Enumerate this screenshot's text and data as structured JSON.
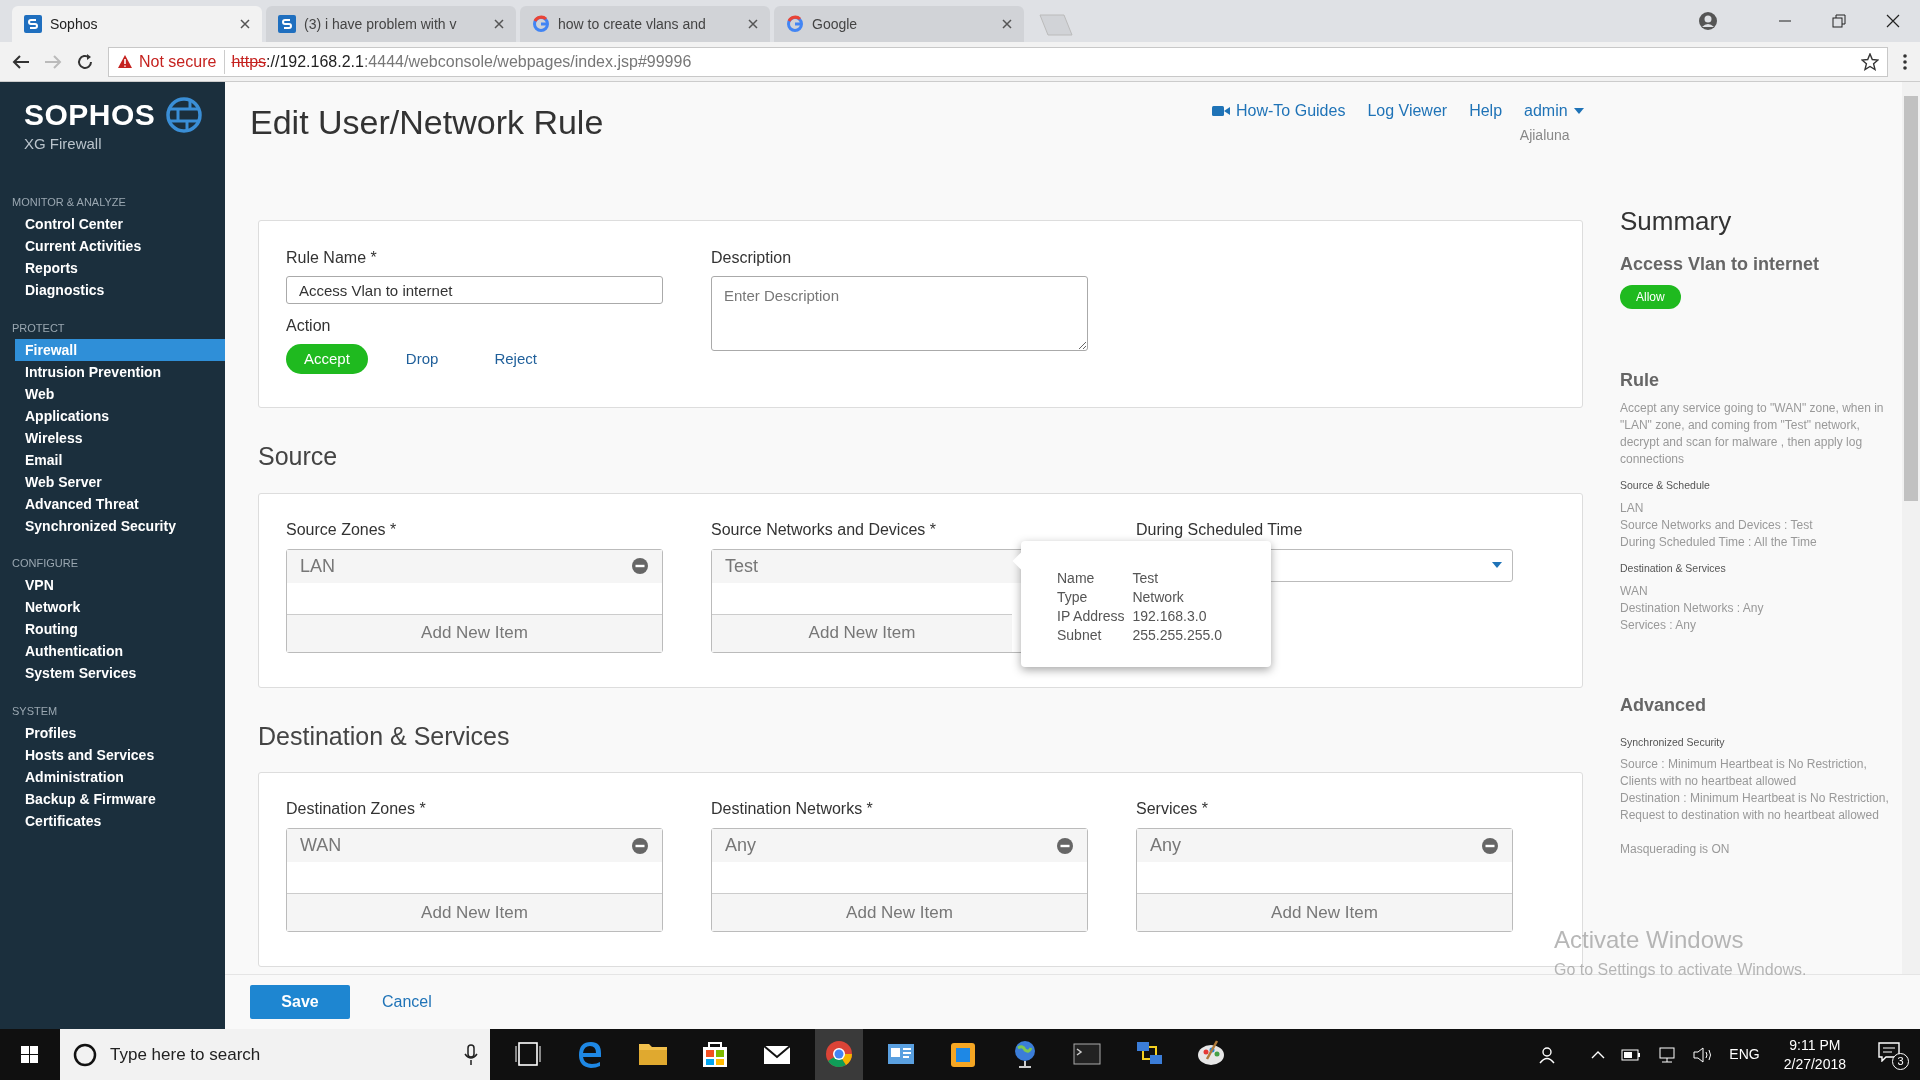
{
  "browser": {
    "tabs": [
      {
        "title": "Sophos",
        "kind": "sophos",
        "selected": true
      },
      {
        "title": "(3) i have problem with v",
        "kind": "sophos",
        "selected": false
      },
      {
        "title": "how to create vlans and",
        "kind": "google",
        "selected": false
      },
      {
        "title": "Google",
        "kind": "google",
        "selected": false
      }
    ],
    "security": "Not secure",
    "scheme": "https",
    "host": "://192.168.2.1",
    "path": ":4444/webconsole/webpages/index.jsp#99996"
  },
  "sidebar": {
    "logo": "SOPHOS",
    "product": "XG Firewall",
    "sections": [
      {
        "title": "MONITOR & ANALYZE",
        "items": [
          {
            "label": "Control Center",
            "selected": false
          },
          {
            "label": "Current Activities",
            "selected": false
          },
          {
            "label": "Reports",
            "selected": false
          },
          {
            "label": "Diagnostics",
            "selected": false
          }
        ]
      },
      {
        "title": "PROTECT",
        "items": [
          {
            "label": "Firewall",
            "selected": true
          },
          {
            "label": "Intrusion Prevention",
            "selected": false
          },
          {
            "label": "Web",
            "selected": false
          },
          {
            "label": "Applications",
            "selected": false
          },
          {
            "label": "Wireless",
            "selected": false
          },
          {
            "label": "Email",
            "selected": false
          },
          {
            "label": "Web Server",
            "selected": false
          },
          {
            "label": "Advanced Threat",
            "selected": false
          },
          {
            "label": "Synchronized Security",
            "selected": false
          }
        ]
      },
      {
        "title": "CONFIGURE",
        "items": [
          {
            "label": "VPN",
            "selected": false
          },
          {
            "label": "Network",
            "selected": false
          },
          {
            "label": "Routing",
            "selected": false
          },
          {
            "label": "Authentication",
            "selected": false
          },
          {
            "label": "System Services",
            "selected": false
          }
        ]
      },
      {
        "title": "SYSTEM",
        "items": [
          {
            "label": "Profiles",
            "selected": false
          },
          {
            "label": "Hosts and Services",
            "selected": false
          },
          {
            "label": "Administration",
            "selected": false
          },
          {
            "label": "Backup & Firmware",
            "selected": false
          },
          {
            "label": "Certificates",
            "selected": false
          }
        ]
      }
    ]
  },
  "page_title": "Edit User/Network Rule",
  "header_links": [
    {
      "label": "How-To Guides",
      "kind": "video"
    },
    {
      "label": "Log Viewer",
      "kind": "plain"
    },
    {
      "label": "Help",
      "kind": "plain"
    },
    {
      "label": "admin",
      "kind": "menu"
    }
  ],
  "org": "Ajialuna",
  "rule_form": {
    "rule_name": {
      "label": "Rule Name *",
      "value": "Access Vlan to internet"
    },
    "description": {
      "label": "Description",
      "placeholder": "Enter Description"
    },
    "action": {
      "label": "Action",
      "options": [
        {
          "label": "Accept",
          "selected": true
        },
        {
          "label": "Drop",
          "selected": false
        },
        {
          "label": "Reject",
          "selected": false
        }
      ]
    }
  },
  "sections": [
    {
      "title": "Source",
      "fields": [
        {
          "kind": "list",
          "label": "Source Zones *",
          "items": [
            "LAN"
          ],
          "add": "Add New Item"
        },
        {
          "kind": "list",
          "label": "Source Networks and Devices *",
          "items": [
            "Test"
          ],
          "add": "Add New Item",
          "tooltip": [
            {
              "key": "Name",
              "value": "Test"
            },
            {
              "key": "Type",
              "value": "Network"
            },
            {
              "key": "IP Address",
              "value": "192.168.3.0"
            },
            {
              "key": "Subnet",
              "value": "255.255.255.0"
            }
          ]
        },
        {
          "kind": "select",
          "label": "During Scheduled Time"
        }
      ]
    },
    {
      "title": "Destination & Services",
      "fields": [
        {
          "kind": "list",
          "label": "Destination Zones *",
          "items": [
            "WAN"
          ],
          "add": "Add New Item"
        },
        {
          "kind": "list",
          "label": "Destination Networks *",
          "items": [
            "Any"
          ],
          "add": "Add New Item"
        },
        {
          "kind": "list",
          "label": "Services *",
          "items": [
            "Any"
          ],
          "add": "Add New Item"
        }
      ]
    }
  ],
  "summary": {
    "title": "Summary",
    "rule_name": "Access Vlan to internet",
    "badge": "Allow",
    "sections": [
      {
        "heading": "Rule",
        "text": "Accept any service going to \"WAN\" zone, when in \"LAN\" zone, and coming from \"Test\" network, decrypt and scan for malware , then apply log connections",
        "groups": [
          {
            "title": "Source & Schedule",
            "lines": [
              "LAN",
              "Source Networks and Devices : Test",
              "During Scheduled Time : All the Time"
            ]
          },
          {
            "title": "Destination & Services",
            "lines": [
              "WAN",
              "Destination Networks : Any",
              "Services : Any"
            ]
          }
        ]
      },
      {
        "heading": "Advanced",
        "groups": [
          {
            "title": "Synchronized Security",
            "lines": [
              "Source : Minimum Heartbeat is No Restriction, Clients with no heartbeat allowed",
              "Destination : Minimum Heartbeat is No Restriction, Request to destination with no heartbeat allowed"
            ]
          }
        ],
        "note": "Masquerading is ON"
      }
    ]
  },
  "buttons": [
    {
      "label": "Save",
      "kind": "primary"
    },
    {
      "label": "Cancel",
      "kind": "link"
    }
  ],
  "activation": {
    "title": "Activate Windows",
    "subtitle": "Go to Settings to activate Windows."
  },
  "taskbar": {
    "search_placeholder": "Type here to search",
    "apps": [
      {
        "kind": "taskview",
        "active": false
      },
      {
        "kind": "edge",
        "active": false
      },
      {
        "kind": "folder",
        "active": false
      },
      {
        "kind": "bag",
        "active": false
      },
      {
        "kind": "mail",
        "active": false
      },
      {
        "kind": "chrome",
        "active": true
      },
      {
        "kind": "card",
        "active": false
      },
      {
        "kind": "cube",
        "active": false
      },
      {
        "kind": "globe",
        "active": false
      },
      {
        "kind": "terminal",
        "active": false
      },
      {
        "kind": "network",
        "active": false
      },
      {
        "kind": "palette",
        "active": false
      }
    ],
    "language": "ENG",
    "time": "9:11 PM",
    "date": "2/27/2018",
    "notifications": "3"
  }
}
